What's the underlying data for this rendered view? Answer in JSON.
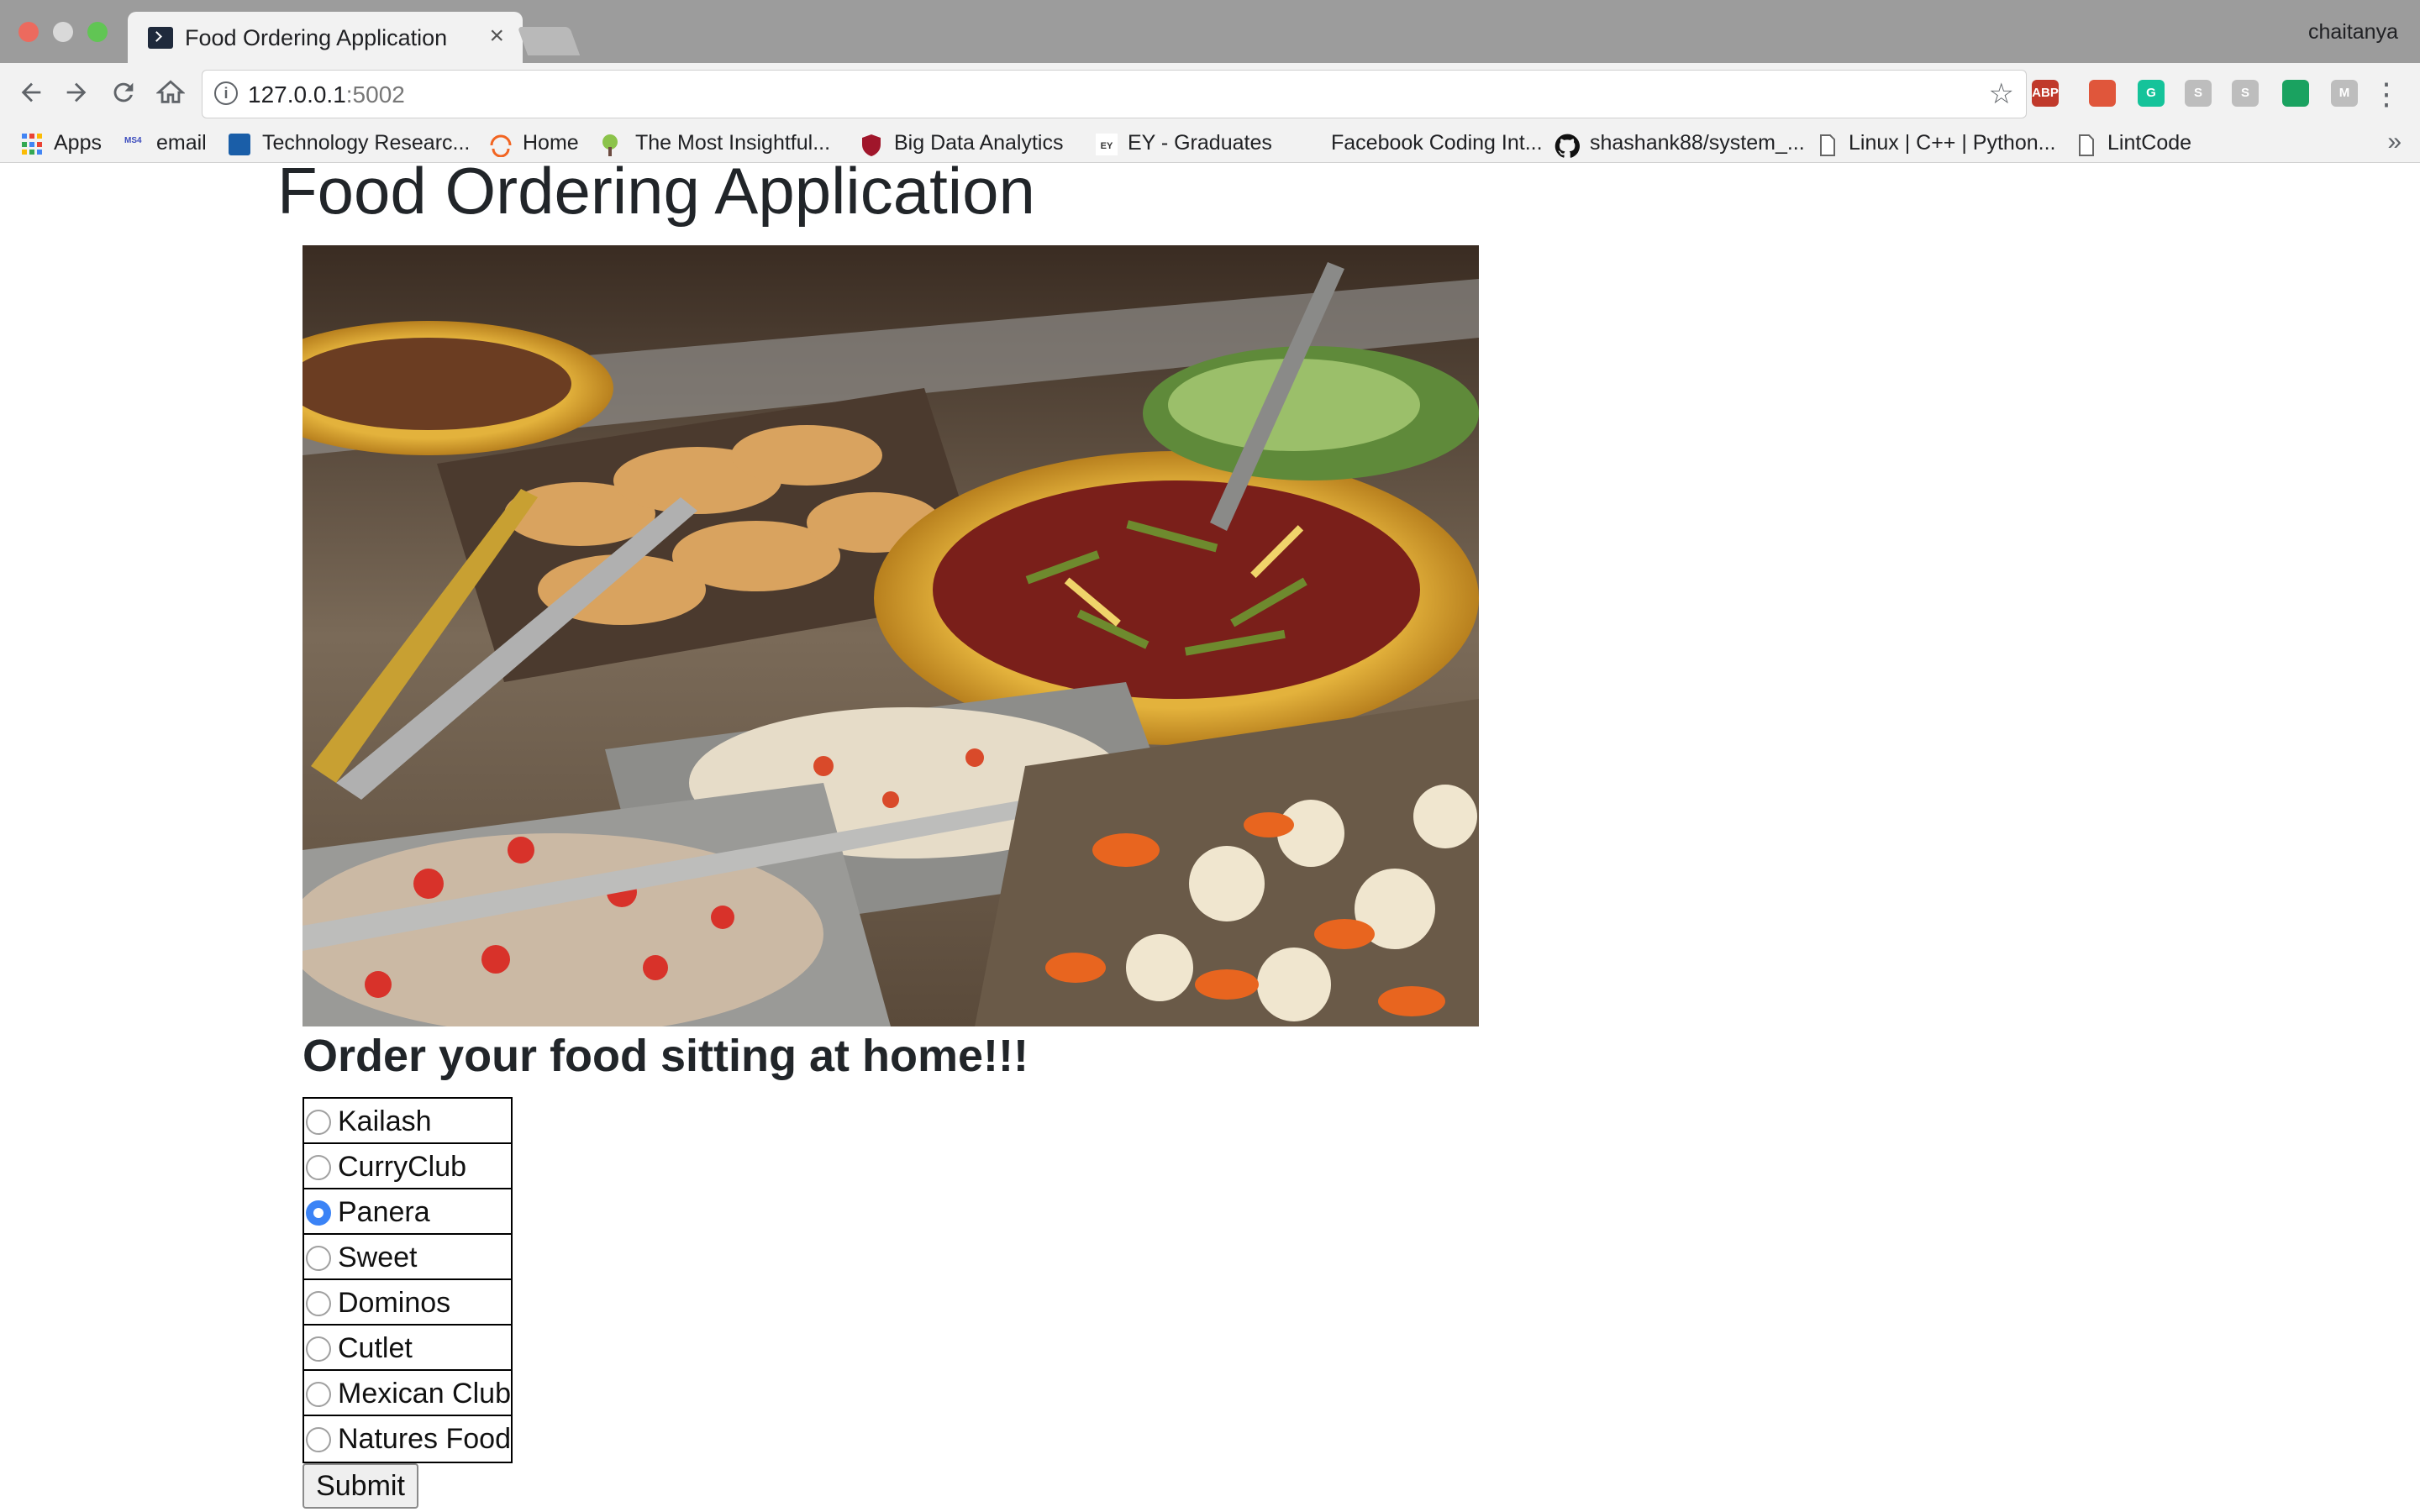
{
  "browser": {
    "tab_title": "Food Ordering Application",
    "tab_close": "×",
    "profile_name": "chaitanya",
    "url_host": "127.0.0.1",
    "url_port": ":5002",
    "extensions": [
      {
        "name": "adblock-plus-icon",
        "text": "ABP",
        "color": "#c0392b"
      },
      {
        "name": "bookmark-red-icon",
        "text": "",
        "color": "#e0563b"
      },
      {
        "name": "grammarly-icon",
        "text": "G",
        "color": "#15c39a"
      },
      {
        "name": "ext-gray-1-icon",
        "text": "S",
        "color": "#bdbdbd"
      },
      {
        "name": "skype-gray-icon",
        "text": "S",
        "color": "#bdbdbd"
      },
      {
        "name": "ext-green-icon",
        "text": "",
        "color": "#1aa260"
      },
      {
        "name": "ext-m-icon",
        "text": "M",
        "color": "#bdbdbd"
      }
    ],
    "bookmarks": [
      {
        "label": "Apps"
      },
      {
        "label": "email"
      },
      {
        "label": "Technology Researc..."
      },
      {
        "label": "Home"
      },
      {
        "label": "The Most Insightful..."
      },
      {
        "label": "Big Data Analytics"
      },
      {
        "label": "EY - Graduates"
      },
      {
        "label": "Facebook Coding Int..."
      },
      {
        "label": "shashank88/system_..."
      },
      {
        "label": "Linux | C++ | Python..."
      },
      {
        "label": "LintCode"
      }
    ],
    "more_bookmarks": "»"
  },
  "page": {
    "title": "Food Ordering Application",
    "hero_image": "buffet food trays with salads, beans, vegetables and tongs",
    "subtitle": "Order your food sitting at home!!!",
    "options": [
      {
        "label": "Kailash",
        "checked": false
      },
      {
        "label": "CurryClub",
        "checked": false
      },
      {
        "label": "Panera",
        "checked": true
      },
      {
        "label": "Sweet",
        "checked": false
      },
      {
        "label": "Dominos",
        "checked": false
      },
      {
        "label": "Cutlet",
        "checked": false
      },
      {
        "label": "Mexican Club",
        "checked": false
      },
      {
        "label": "Natures Food",
        "checked": false
      }
    ],
    "submit_label": "Submit"
  }
}
